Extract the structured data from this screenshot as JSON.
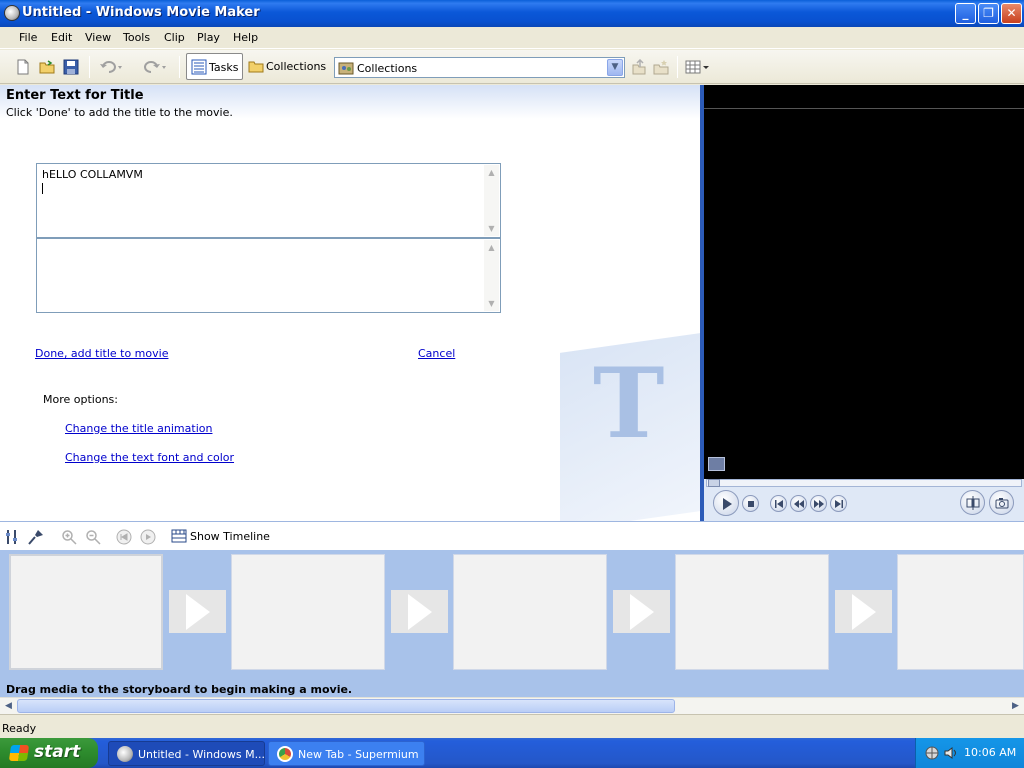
{
  "window": {
    "title": "Untitled - Windows Movie Maker",
    "minimize": "_",
    "maximize": "❐",
    "close": "✕"
  },
  "menu": [
    "File",
    "Edit",
    "View",
    "Tools",
    "Clip",
    "Play",
    "Help"
  ],
  "toolbar": {
    "tasks_label": "Tasks",
    "collections_label": "Collections",
    "collections_dropdown_value": "Collections"
  },
  "tasks_pane": {
    "title": "Enter Text for Title",
    "subtitle": "Click 'Done' to add the title to the movie.",
    "title_text_value": "hELLO COLLAMVM",
    "done_link": "Done, add title to movie",
    "cancel_link": "Cancel",
    "more_options_label": "More options:",
    "change_animation_link": "Change the title animation",
    "change_font_link": "Change the text font and color",
    "watermark_glyph": "T"
  },
  "storyboard": {
    "show_timeline_label": "Show Timeline",
    "hint": "Drag media to the storyboard to begin making a movie."
  },
  "status": {
    "text": "Ready"
  },
  "taskbar": {
    "start_label": "start",
    "tasks": [
      {
        "label": "Untitled - Windows M..."
      },
      {
        "label": "New Tab - Supermium"
      }
    ],
    "clock": "10:06 AM"
  },
  "colors": {
    "titlebar": "#0a5fd8",
    "link": "#0000cc",
    "storyboard_bg": "#a8c2ea",
    "divider": "#2c5bb8"
  }
}
